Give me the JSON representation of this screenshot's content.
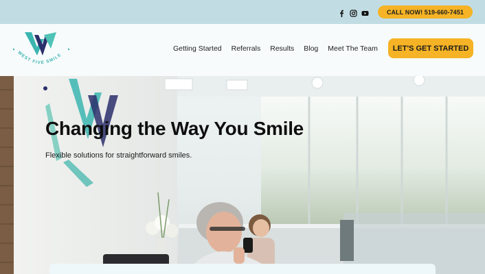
{
  "topbar": {
    "social": [
      "facebook-icon",
      "instagram-icon",
      "youtube-icon"
    ],
    "call_label": "CALL NOW! 519-660-7451"
  },
  "header": {
    "logo_text": "WEST FIVE SMILE",
    "nav": [
      "Getting Started",
      "Referrals",
      "Results",
      "Blog",
      "Meet The Team"
    ],
    "cta_label": "LET'S GET STARTED"
  },
  "hero": {
    "title": "Changing the Way You Smile",
    "subtitle": "Flexible solutions for straightforward smiles."
  },
  "colors": {
    "topbar": "#c1dde3",
    "accent": "#f5b325",
    "logo_teal": "#3bb5b0",
    "logo_navy": "#2b2f6b"
  }
}
